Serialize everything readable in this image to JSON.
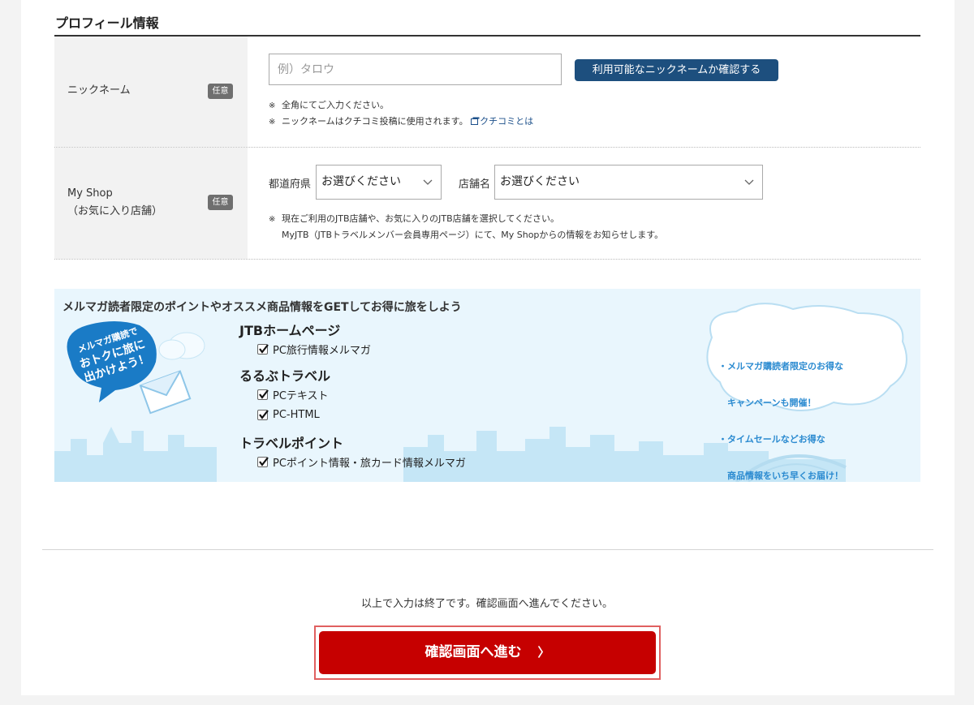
{
  "section": {
    "title": "プロフィール情報"
  },
  "nickname": {
    "label": "ニックネーム",
    "badge": "任意",
    "placeholder": "例）タロウ",
    "check_button": "利用可能なニックネームか確認する",
    "note_mark": "※",
    "note1": "全角にてご入力ください。",
    "note2": "ニックネームはクチコミ投稿に使用されます。",
    "link": "クチコミとは"
  },
  "myshop": {
    "label_line1": "My Shop",
    "label_line2": "（お気に入り店舗）",
    "badge": "任意",
    "pref_label": "都道府県",
    "pref_value": "お選びください",
    "store_label": "店舗名",
    "store_value": "お選びください",
    "note_mark": "※",
    "note1": "現在ご利用のJTB店舗や、お気に入りのJTB店舗を選択してください。",
    "note2": "MyJTB（JTBトラベルメンバー会員専用ページ）にて、My Shopからの情報をお知らせします。"
  },
  "newsletter": {
    "title": "メルマガ読者限定のポイントやオススメ商品情報をGETしてお得に旅をしよう",
    "bubble_text": [
      "メルマガ購読で",
      "おトクに旅に",
      "出かけよう！"
    ],
    "cloud_text": [
      "・メルマガ購読者限定のお得な",
      "　キャンペーンも開催！",
      "・タイムセールなどお得な",
      "　商品情報をいち早くお届け！"
    ],
    "groups": [
      {
        "name": "JTBホームページ",
        "items": [
          {
            "label": "PC旅行情報メルマガ",
            "checked": true
          }
        ]
      },
      {
        "name": "るるぶトラベル",
        "items": [
          {
            "label": "PCテキスト",
            "checked": true
          },
          {
            "label": "PC-HTML",
            "checked": true
          }
        ]
      },
      {
        "name": "トラベルポイント",
        "items": [
          {
            "label": "PCポイント情報・旅カード情報メルマガ",
            "checked": true
          }
        ]
      }
    ]
  },
  "footer": {
    "message": "以上で入力は終了です。確認画面へ進んでください。",
    "submit": "確認画面へ進む",
    "submit_arrow": "〉"
  },
  "colors": {
    "primary_blue": "#1d4f7e",
    "submit_red": "#c60000",
    "badge_gray": "#6f6f6f"
  }
}
